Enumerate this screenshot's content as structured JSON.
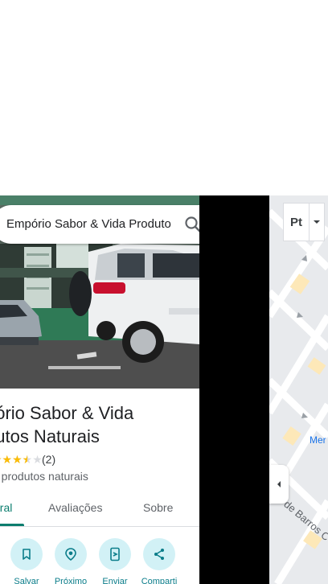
{
  "search": {
    "query": "Empório Sabor & Vida Produto"
  },
  "place": {
    "title_line1": "pório Sabor & Vida",
    "title_line2": "dutos Naturais",
    "stars": "★★★★★",
    "rating": 3.5,
    "review_count": "(2)",
    "category": "e produtos naturais"
  },
  "tabs": [
    {
      "label": "eral",
      "active": true
    },
    {
      "label": "Avaliações",
      "active": false
    },
    {
      "label": "Sobre",
      "active": false
    }
  ],
  "actions": [
    {
      "label": "Salvar",
      "icon": "bookmark-icon"
    },
    {
      "label": "Próximo",
      "icon": "nearby-icon"
    },
    {
      "label": "Enviar",
      "icon": "send-to-phone-icon"
    },
    {
      "label": "Comparti",
      "icon": "share-icon"
    }
  ],
  "map": {
    "layer_label": "Pt",
    "labels": {
      "street": "de Barros C",
      "place": "Mer",
      "street2": "s"
    }
  },
  "colors": {
    "accent": "#0b7d6e",
    "action_bg": "#d2f1f6",
    "star": "#fbbc04",
    "map_blue": "#1a73e8"
  }
}
